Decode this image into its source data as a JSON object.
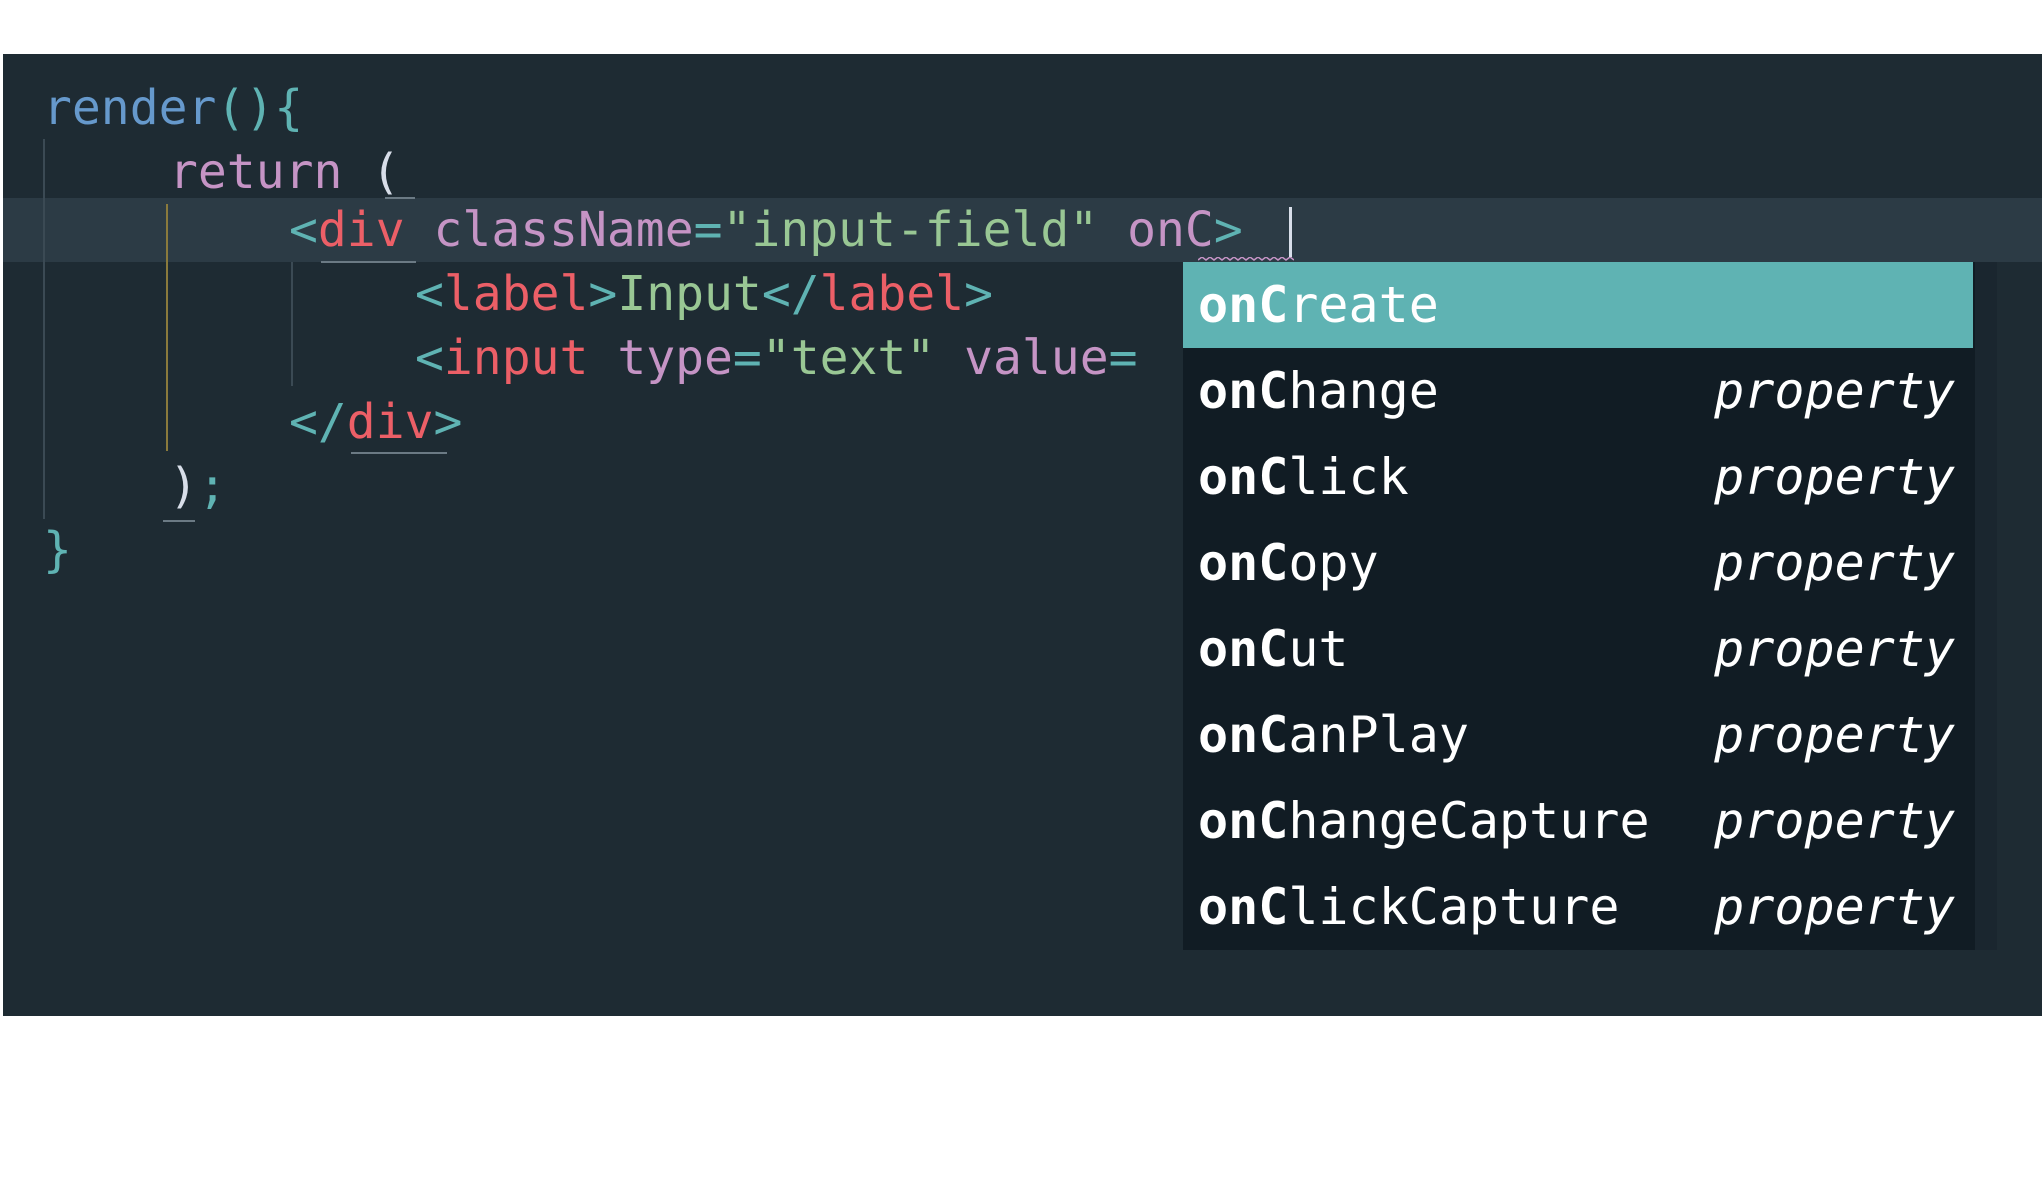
{
  "code": {
    "line1": {
      "fn": "render",
      "punct": "(){"
    },
    "line2": {
      "kw": "return",
      "punct": "("
    },
    "line3": {
      "open": "<",
      "tag": "div",
      "attr": "className",
      "eq": "=",
      "str": "\"input-field\"",
      "typed": "onC",
      "close": ">"
    },
    "line4": {
      "open1": "<",
      "tag1": "label",
      "close1": ">",
      "text": "Input",
      "open2": "</",
      "tag2": "label",
      "close2": ">"
    },
    "line5": {
      "open": "<",
      "tag": "input",
      "attr1": "type",
      "eq1": "=",
      "str1": "\"text\"",
      "attr2": "value",
      "eq2": "="
    },
    "line6": {
      "open": "</",
      "tag": "div",
      "close": ">"
    },
    "line7": {
      "paren": ")",
      "semi": ";"
    },
    "line8": {
      "brace": "}"
    }
  },
  "autocomplete": {
    "match_prefix": "onC",
    "items": [
      {
        "rest": "reate",
        "kind": ""
      },
      {
        "rest": "hange",
        "kind": "property"
      },
      {
        "rest": "lick",
        "kind": "property"
      },
      {
        "rest": "opy",
        "kind": "property"
      },
      {
        "rest": "ut",
        "kind": "property"
      },
      {
        "rest": "anPlay",
        "kind": "property"
      },
      {
        "rest": "hangeCapture",
        "kind": "property"
      },
      {
        "rest": "lickCapture",
        "kind": "property"
      }
    ],
    "selected_index": 0
  },
  "colors": {
    "background": "#1e2b33",
    "current_line": "#2c3b45",
    "popup_background": "#111c24",
    "selection": "#5fb3b3"
  }
}
